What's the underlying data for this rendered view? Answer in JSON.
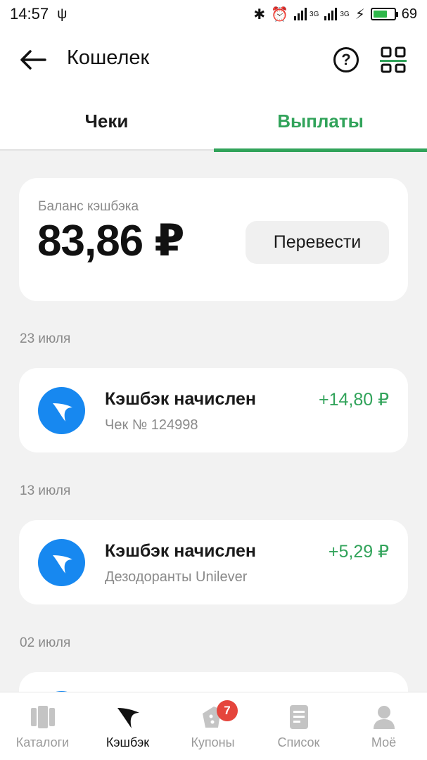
{
  "status_bar": {
    "time": "14:57",
    "battery_level": "69",
    "battery_fill": 0.69,
    "network": "3G"
  },
  "header": {
    "title": "Кошелек"
  },
  "tabs": [
    {
      "label": "Чеки",
      "active": false
    },
    {
      "label": "Выплаты",
      "active": true
    }
  ],
  "balance": {
    "label": "Баланс кэшбэка",
    "value": "83,86 ₽",
    "transfer_button": "Перевести"
  },
  "transactions": [
    {
      "date": "23 июля",
      "title": "Кэшбэк начислен",
      "subtitle": "Чек № 124998",
      "amount": "+14,80 ₽"
    },
    {
      "date": "13 июля",
      "title": "Кэшбэк начислен",
      "subtitle": "Дезодоранты Unilever",
      "amount": "+5,29 ₽"
    },
    {
      "date": "02 июля"
    }
  ],
  "bottom_nav": [
    {
      "label": "Каталоги",
      "icon": "catalogs-icon"
    },
    {
      "label": "Кэшбэк",
      "icon": "cashback-icon",
      "active": true
    },
    {
      "label": "Купоны",
      "icon": "coupons-icon",
      "badge": "7"
    },
    {
      "label": "Список",
      "icon": "list-icon"
    },
    {
      "label": "Моё",
      "icon": "profile-icon"
    }
  ],
  "colors": {
    "accent_green": "#31a35a",
    "cashback_blue": "#1788f0",
    "badge_red": "#e5453c"
  }
}
